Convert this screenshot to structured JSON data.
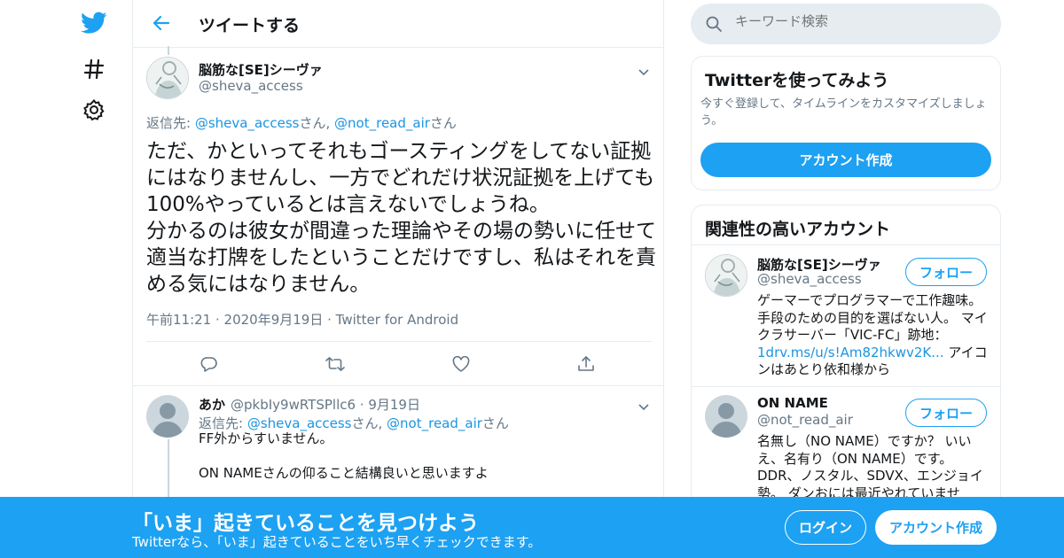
{
  "colors": {
    "brand": "#1da1f2",
    "link": "#1b95e0",
    "muted": "#657786",
    "border": "#e6ecf0"
  },
  "left_nav": {
    "icons": [
      "twitter-bird-icon",
      "hashtag-icon",
      "gear-icon"
    ]
  },
  "header": {
    "title": "ツイートする"
  },
  "tweet": {
    "display_name": "脳筋な[SE]シーヴァ",
    "handle": "@sheva_access",
    "reply_prefix": "返信先: ",
    "reply_user1": "@sheva_access",
    "reply_suffix1": "さん, ",
    "reply_user2": "@not_read_air",
    "reply_suffix2": "さん",
    "text": "ただ、かといってそれもゴースティングをしてない証拠にはなりませんし、一方でどれだけ状況証拠を上げても100%やっているとは言えないでしょうね。\n分かるのは彼女が間違った理論やその場の勢いに任せて適当な打牌をしたということだけですし、私はそれを責める気にはなりません。",
    "time": "午前11:21",
    "date": "2020年9月19日",
    "source": "Twitter for Android"
  },
  "reply": {
    "display_name": "あか",
    "handle": "@pkbIy9wRTSPllc6",
    "date": "9月19日",
    "reply_prefix": "返信先: ",
    "reply_user1": "@sheva_access",
    "reply_suffix1": "さん, ",
    "reply_user2": "@not_read_air",
    "reply_suffix2": "さん",
    "line1": "FF外からすいません。",
    "line2": "ON NAMEさんの仰ること結構良いと思いますよ"
  },
  "search": {
    "placeholder": "キーワード検索"
  },
  "try_card": {
    "title": "Twitterを使ってみよう",
    "subtitle": "今すぐ登録して、タイムラインをカスタマイズしましょう。",
    "button": "アカウント作成"
  },
  "related": {
    "title": "関連性の高いアカウント",
    "accounts": [
      {
        "name": "脳筋な[SE]シーヴァ",
        "handle": "@sheva_access",
        "follow": "フォロー",
        "bio_pre": "ゲーマーでプログラマーで工作趣味。手段のための目的を選ばない人。 マイクラサーバー「VIC-FC」跡地：",
        "bio_link": "1drv.ms/u/s!Am82hkwv2K...",
        "bio_post": " アイコンはあとり依和様から"
      },
      {
        "name": "ON NAME",
        "handle": "@not_read_air",
        "follow": "フォロー",
        "bio_pre": "名無し（NO NAME）ですか？ いいえ、名有り（ON NAME）です。 DDR、ノスタル、SDVX、エンジョイ勢。 ダンおには最近やれていませ"
      }
    ]
  },
  "bottom_bar": {
    "title": "「いま」起きていることを見つけよう",
    "subtitle": "Twitterなら、「いま」起きていることをいち早くチェックできます。",
    "login": "ログイン",
    "signup": "アカウント作成"
  }
}
